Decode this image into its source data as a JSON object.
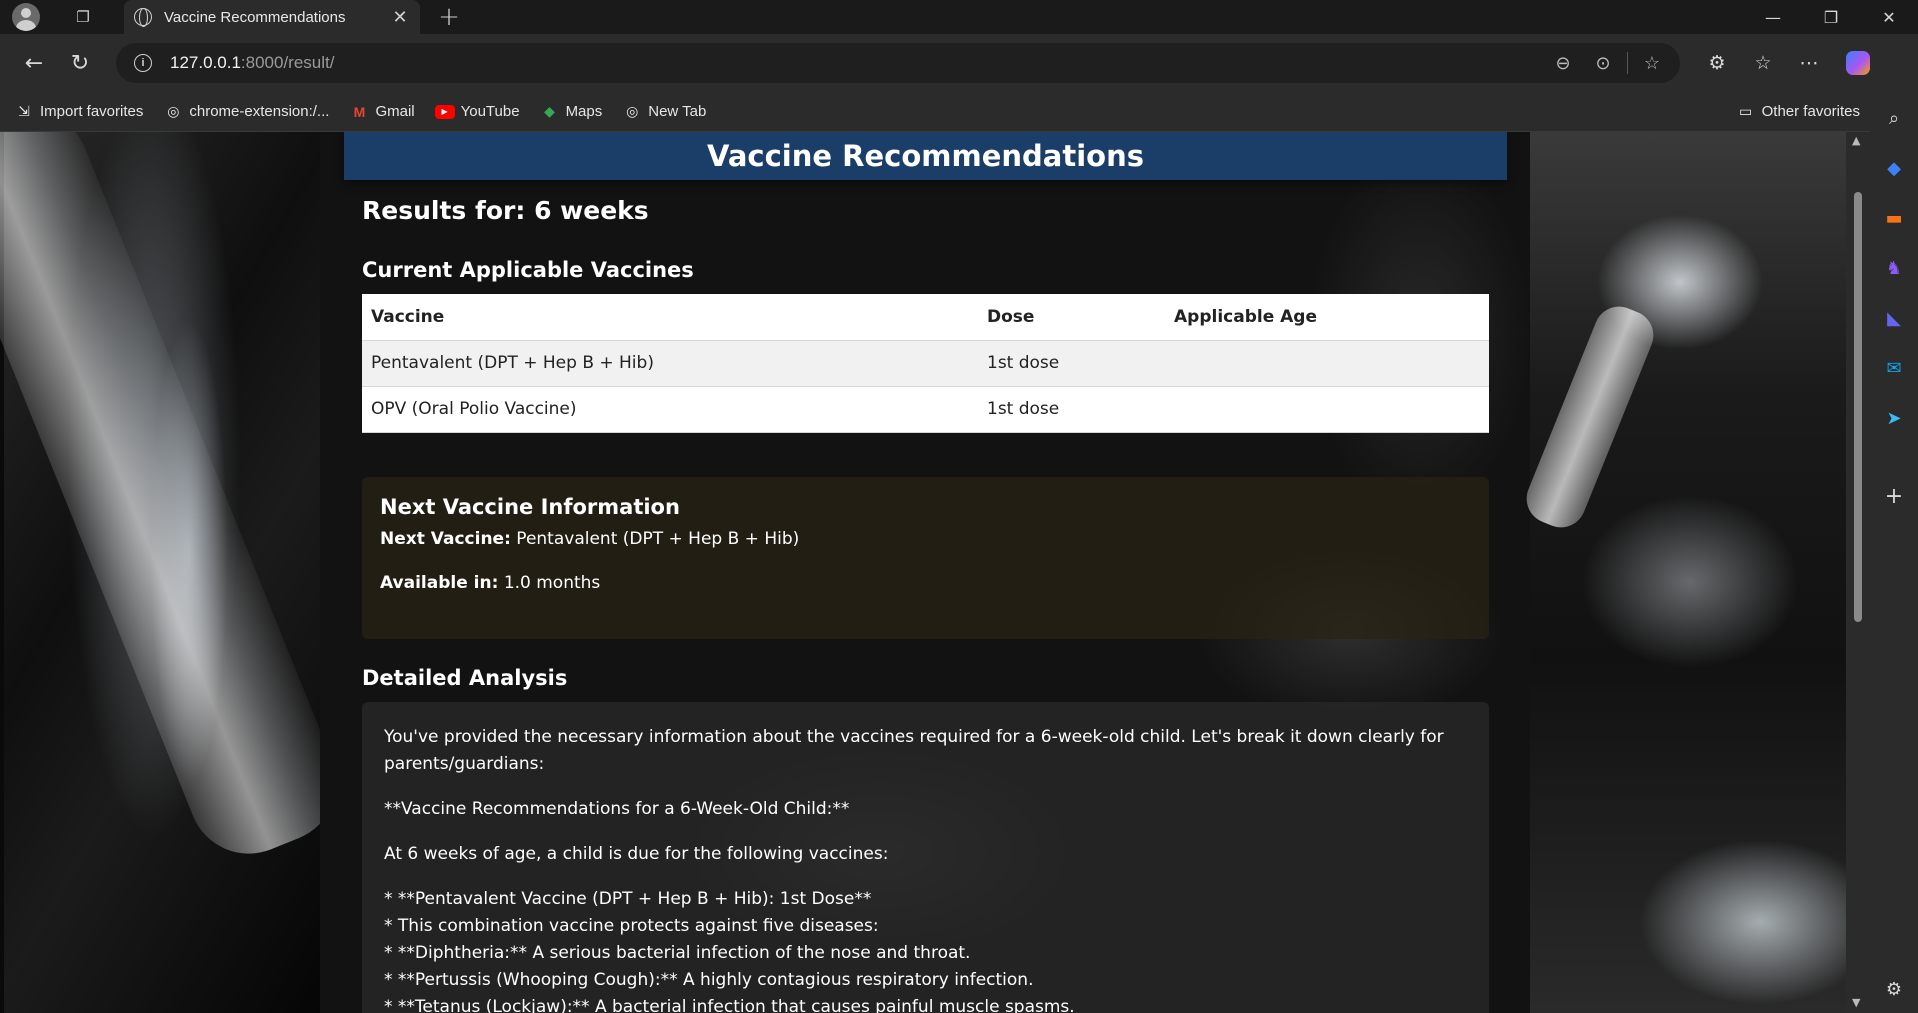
{
  "browser": {
    "tab_title": "Vaccine Recommendations",
    "url_host": "127.0.0.1",
    "url_rest": ":8000/result/",
    "favorites": [
      "Import favorites",
      "chrome-extension:/...",
      "Gmail",
      "YouTube",
      "Maps",
      "New Tab"
    ],
    "other_favorites": "Other favorites"
  },
  "page": {
    "header": "Vaccine Recommendations",
    "results_title": "Results for: 6 weeks",
    "current_title": "Current Applicable Vaccines",
    "table": {
      "headers": [
        "Vaccine",
        "Dose",
        "Applicable Age"
      ],
      "rows": [
        [
          "Pentavalent (DPT + Hep B + Hib)",
          "1st dose",
          ""
        ],
        [
          "OPV (Oral Polio Vaccine)",
          "1st dose",
          ""
        ]
      ]
    },
    "next": {
      "title": "Next Vaccine Information",
      "vaccine_label": "Next Vaccine:",
      "vaccine_value": "Pentavalent (DPT + Hep B + Hib)",
      "available_label": "Available in:",
      "available_value": "1.0 months"
    },
    "detail_title": "Detailed Analysis",
    "analysis": {
      "intro": "You've provided the necessary information about the vaccines required for a 6-week-old child. Let's break it down clearly for parents/guardians:",
      "heading": "**Vaccine Recommendations for a 6-Week-Old Child:**",
      "lead": "At 6 weeks of age, a child is due for the following vaccines:",
      "lines": [
        "* **Pentavalent Vaccine (DPT + Hep B + Hib): 1st Dose**",
        "* This combination vaccine protects against five diseases:",
        "* **Diphtheria:** A serious bacterial infection of the nose and throat.",
        "* **Pertussis (Whooping Cough):** A highly contagious respiratory infection.",
        "* **Tetanus (Lockjaw):** A bacterial infection that causes painful muscle spasms."
      ]
    }
  }
}
